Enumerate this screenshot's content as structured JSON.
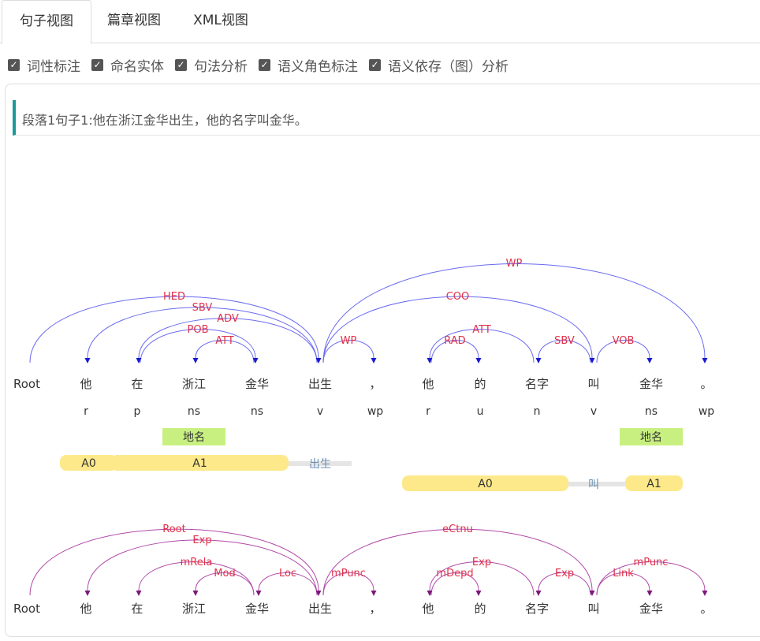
{
  "tabs": [
    {
      "label": "句子视图",
      "active": true
    },
    {
      "label": "篇章视图",
      "active": false
    },
    {
      "label": "XML视图",
      "active": false
    }
  ],
  "options": [
    {
      "label": "词性标注",
      "checked": true
    },
    {
      "label": "命名实体",
      "checked": true
    },
    {
      "label": "句法分析",
      "checked": true
    },
    {
      "label": "语义角色标注",
      "checked": true
    },
    {
      "label": "语义依存（图）分析",
      "checked": true
    }
  ],
  "sentence": "段落1句子1:他在浙江金华出生，他的名字叫金华。",
  "words": [
    "Root",
    "他",
    "在",
    "浙江",
    "金华",
    "出生",
    "，",
    "他",
    "的",
    "名字",
    "叫",
    "金华",
    "。"
  ],
  "pos": [
    "",
    "r",
    "p",
    "ns",
    "ns",
    "v",
    "wp",
    "r",
    "u",
    "n",
    "v",
    "ns",
    "wp"
  ],
  "ner": [
    {
      "word": 3,
      "label": "地名"
    },
    {
      "word": 11,
      "label": "地名"
    }
  ],
  "srl": [
    {
      "predicate": "出生",
      "args": [
        {
          "label": "A0",
          "from": 1,
          "to": 1
        },
        {
          "label": "A1",
          "from": 2,
          "to": 4
        }
      ],
      "pred_index": 5
    },
    {
      "predicate": "叫",
      "args": [
        {
          "label": "A0",
          "from": 7,
          "to": 9
        },
        {
          "label": "A1",
          "from": 11,
          "to": 11
        }
      ],
      "pred_index": 10
    }
  ],
  "dependency": [
    {
      "head": 0,
      "dep": 5,
      "label": "HED"
    },
    {
      "head": 5,
      "dep": 1,
      "label": "SBV"
    },
    {
      "head": 5,
      "dep": 2,
      "label": "ADV"
    },
    {
      "head": 2,
      "dep": 4,
      "label": "POB"
    },
    {
      "head": 4,
      "dep": 3,
      "label": "ATT"
    },
    {
      "head": 5,
      "dep": 6,
      "label": "WP"
    },
    {
      "head": 5,
      "dep": 10,
      "label": "COO"
    },
    {
      "head": 5,
      "dep": 12,
      "label": "WP"
    },
    {
      "head": 9,
      "dep": 7,
      "label": "ATT"
    },
    {
      "head": 7,
      "dep": 8,
      "label": "RAD"
    },
    {
      "head": 10,
      "dep": 9,
      "label": "SBV"
    },
    {
      "head": 10,
      "dep": 11,
      "label": "VOB"
    }
  ],
  "semantic": [
    {
      "head": 0,
      "dep": 5,
      "label": "Root"
    },
    {
      "head": 5,
      "dep": 1,
      "label": "Exp"
    },
    {
      "head": 4,
      "dep": 2,
      "label": "mRela"
    },
    {
      "head": 4,
      "dep": 3,
      "label": "Mod"
    },
    {
      "head": 5,
      "dep": 4,
      "label": "Loc"
    },
    {
      "head": 5,
      "dep": 6,
      "label": "mPunc"
    },
    {
      "head": 5,
      "dep": 10,
      "label": "eCtnu"
    },
    {
      "head": 7,
      "dep": 8,
      "label": "mDepd"
    },
    {
      "head": 9,
      "dep": 7,
      "label": "Exp"
    },
    {
      "head": 10,
      "dep": 9,
      "label": "Exp"
    },
    {
      "head": 10,
      "dep": 11,
      "label": "Link"
    },
    {
      "head": 10,
      "dep": 12,
      "label": "mPunc"
    }
  ],
  "colors": {
    "tab_border": "#dddddd",
    "sentence_accent": "#1a9a9a",
    "dep_arc": "#6a6af0",
    "dep_arrow": "#1a1ad0",
    "arc_label": "#e0304a",
    "sdp_arc": "#b04aa8",
    "sdp_arrow": "#7a1a7a",
    "ner_bg": "#c8f080",
    "srl_arg_bg": "#fde98a",
    "srl_pred_line": "#e5e5e5",
    "srl_pred_text": "#6a8fb0"
  }
}
